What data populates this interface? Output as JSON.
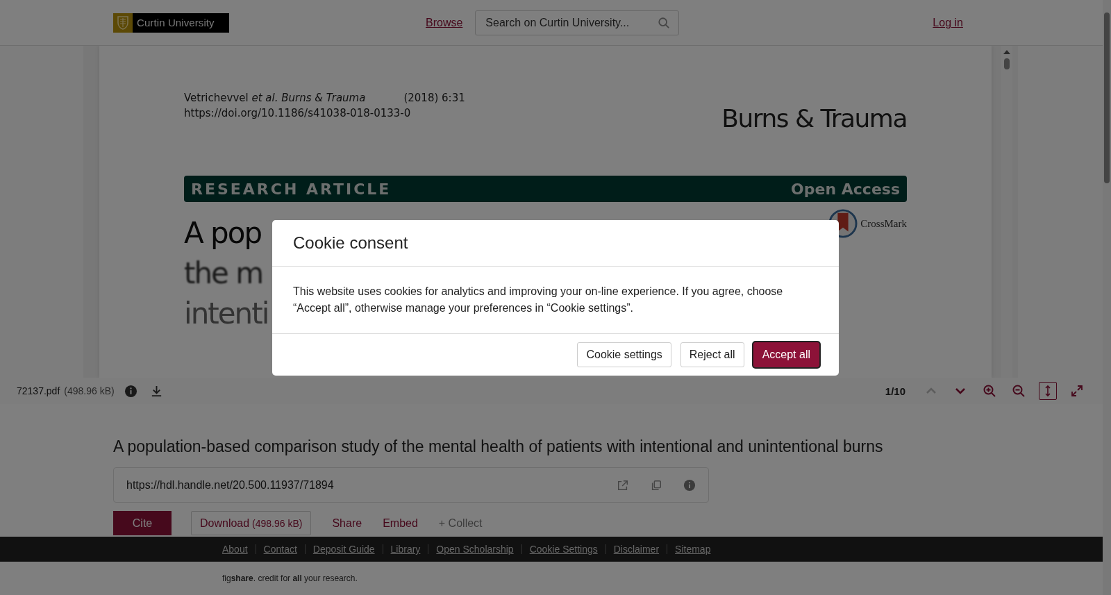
{
  "header": {
    "logo_text": "Curtin University",
    "nav_link": "Browse",
    "search": {
      "placeholder": "Search on Curtin University..."
    },
    "login": "Log in"
  },
  "viewer": {
    "page": {
      "citation": "Vetrichevvel *et al. Burns & Trauma*",
      "year": "(2018) 6:31",
      "doi": "https://doi.org/10.1186/s41038-018-0133-0",
      "journal": "Burns & Trauma",
      "banner_left": "RESEARCH ARTICLE",
      "banner_right": "Open Access",
      "crossmark": "CrossMark",
      "title_lines": [
        "A pop",
        "the m",
        "intenti"
      ]
    },
    "toolbar": {
      "filename": "72137.pdf",
      "size": "(498.96 kB)",
      "page": "1/10",
      "controls": [
        {
          "kind": "up",
          "disabled": true,
          "selected": false
        },
        {
          "kind": "down",
          "disabled": false,
          "selected": false
        },
        {
          "kind": "zoom-in",
          "disabled": false,
          "selected": false
        },
        {
          "kind": "zoom-out",
          "disabled": false,
          "selected": false
        },
        {
          "kind": "fit-height",
          "disabled": false,
          "selected": true
        },
        {
          "kind": "fullscreen",
          "disabled": false,
          "selected": false
        }
      ]
    }
  },
  "article": {
    "title": "A population-based comparison study of the mental health of patients with intentional and unintentional burns",
    "handle_url": "https://hdl.handle.net/20.500.11937/71894",
    "actions": [
      {
        "kind": "primary",
        "label": "Cite"
      },
      {
        "kind": "outline",
        "label": "Download",
        "size": "(498.96 kB)"
      },
      {
        "kind": "link",
        "label": "Share"
      },
      {
        "kind": "link",
        "label": "Embed"
      },
      {
        "kind": "muted",
        "label": "+ Collect"
      }
    ]
  },
  "footer": {
    "links": [
      "About",
      "Contact",
      "Deposit Guide",
      "Library",
      "Open Scholarship",
      "Cookie Settings",
      "Disclaimer",
      "Sitemap"
    ],
    "tagline": "fig**share**. credit for **all** your research."
  },
  "modal": {
    "title": "Cookie consent",
    "body": "This website uses cookies for analytics and improving your on-line experience. If you agree, choose “Accept all”, otherwise manage your preferences in “Cookie settings”.",
    "buttons": [
      {
        "label": "Cookie settings",
        "kind": "secondary"
      },
      {
        "label": "Reject all",
        "kind": "secondary"
      },
      {
        "label": "Accept all",
        "kind": "primary"
      }
    ]
  }
}
